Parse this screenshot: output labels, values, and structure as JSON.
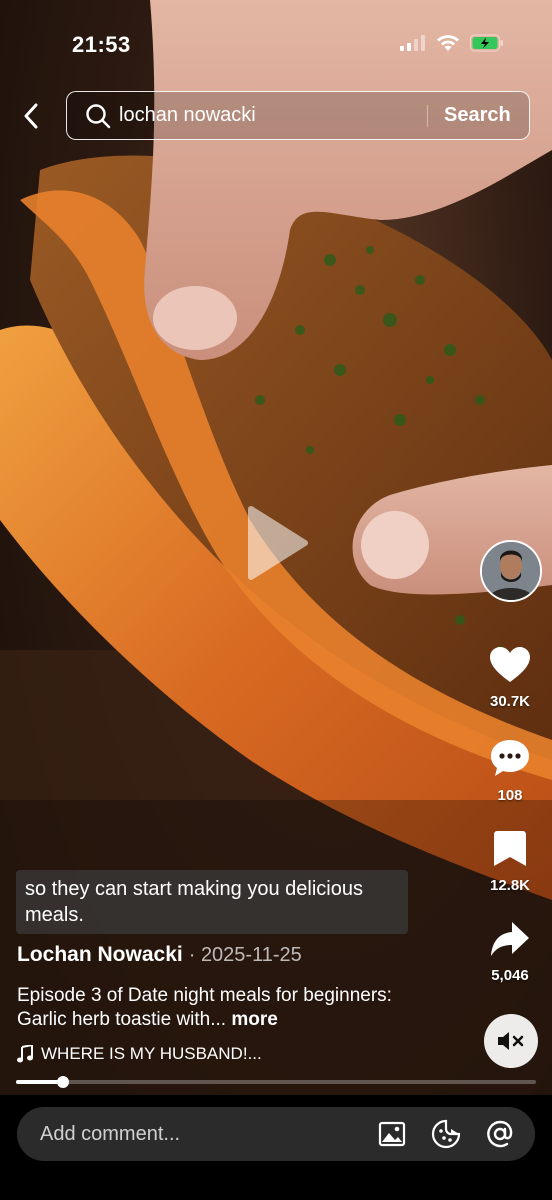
{
  "status_bar": {
    "time": "21:53"
  },
  "search": {
    "query": "lochan nowacki",
    "button_label": "Search"
  },
  "video": {
    "subtitle": "so they can start making you delicious meals.",
    "author": "Lochan Nowacki",
    "date_separator": "·",
    "date": "2025-11-25",
    "description": "Episode 3 of Date night meals for beginners: Garlic herb toastie with...",
    "more_label": "more",
    "music": "WHERE IS MY HUSBAND!...",
    "progress": 0.09
  },
  "actions": {
    "likes": "30.7K",
    "comments": "108",
    "saves": "12.8K",
    "shares": "5,046"
  },
  "comment_bar": {
    "placeholder": "Add comment..."
  },
  "colors": {
    "accent": "#ffffff",
    "comment_bg": "#2b2b2b",
    "battery": "#34c759"
  },
  "icons": [
    "back-chevron-icon",
    "search-icon",
    "play-icon",
    "heart-icon",
    "comment-bubble-icon",
    "bookmark-icon",
    "share-icon",
    "mute-icon",
    "music-note-icon",
    "image-icon",
    "emoji-icon",
    "at-icon"
  ]
}
